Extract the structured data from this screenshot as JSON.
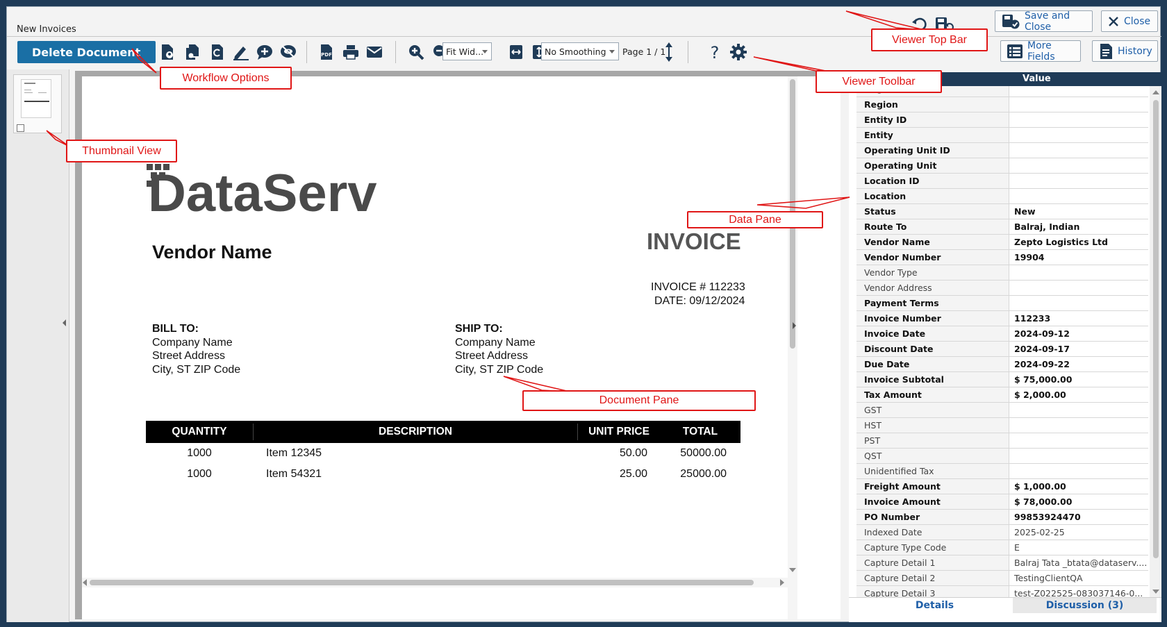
{
  "window": {
    "title": "New Invoices"
  },
  "top_bar": {
    "save_close_label": "Save and Close",
    "close_label": "Close",
    "more_fields_label": "More Fields",
    "history_label": "History"
  },
  "toolbar": {
    "delete_label": "Delete Document",
    "zoom_select": "Fit Wid...",
    "smoothing_select": "No Smoothing",
    "page_indicator": "Page 1 / 1"
  },
  "document": {
    "logo_text": "DataServ",
    "vendor_name": "Vendor Name",
    "heading": "INVOICE",
    "invoice_no": "INVOICE # 112233",
    "date": "DATE: 09/12/2024",
    "bill_to": {
      "title": "BILL TO:",
      "lines": [
        "Company Name",
        "Street Address",
        "City, ST ZIP Code"
      ]
    },
    "ship_to": {
      "title": "SHIP TO:",
      "lines": [
        "Company Name",
        "Street Address",
        "City, ST ZIP Code"
      ]
    },
    "table": {
      "headers": [
        "QUANTITY",
        "DESCRIPTION",
        "UNIT PRICE",
        "TOTAL"
      ],
      "rows": [
        [
          "1000",
          "Item 12345",
          "50.00",
          "50000.00"
        ],
        [
          "1000",
          "Item 54321",
          "25.00",
          "25000.00"
        ]
      ]
    }
  },
  "data_pane": {
    "header": "Value",
    "tabs": {
      "details": "Details",
      "discussion": "Discussion (3)"
    },
    "rows": [
      {
        "label": "Region ID",
        "value": ""
      },
      {
        "label": "Region",
        "value": ""
      },
      {
        "label": "Entity ID",
        "value": ""
      },
      {
        "label": "Entity",
        "value": ""
      },
      {
        "label": "Operating Unit ID",
        "value": ""
      },
      {
        "label": "Operating Unit",
        "value": ""
      },
      {
        "label": "Location ID",
        "value": ""
      },
      {
        "label": "Location",
        "value": ""
      },
      {
        "label": "Status",
        "value": "New"
      },
      {
        "label": "Route To",
        "value": "Balraj, Indian"
      },
      {
        "label": "Vendor Name",
        "value": "Zepto Logistics Ltd"
      },
      {
        "label": "Vendor Number",
        "value": "19904"
      },
      {
        "label": "Vendor Type",
        "value": ""
      },
      {
        "label": "Vendor Address",
        "value": ""
      },
      {
        "label": "Payment Terms",
        "value": ""
      },
      {
        "label": "Invoice Number",
        "value": "112233"
      },
      {
        "label": "Invoice Date",
        "value": "2024-09-12"
      },
      {
        "label": "Discount Date",
        "value": "2024-09-17"
      },
      {
        "label": "Due Date",
        "value": "2024-09-22"
      },
      {
        "label": "Invoice Subtotal",
        "value": "$ 75,000.00"
      },
      {
        "label": "Tax Amount",
        "value": "$ 2,000.00"
      },
      {
        "label": "GST",
        "value": ""
      },
      {
        "label": "HST",
        "value": ""
      },
      {
        "label": "PST",
        "value": ""
      },
      {
        "label": "QST",
        "value": ""
      },
      {
        "label": "Unidentified Tax",
        "value": ""
      },
      {
        "label": "Freight Amount",
        "value": "$ 1,000.00"
      },
      {
        "label": "Invoice Amount",
        "value": "$ 78,000.00"
      },
      {
        "label": "PO Number",
        "value": "99853924470"
      },
      {
        "label": "Indexed Date",
        "value": "2025-02-25"
      },
      {
        "label": "Capture Type Code",
        "value": "E"
      },
      {
        "label": "Capture Detail 1",
        "value": "Balraj Tata _btata@dataserv...."
      },
      {
        "label": "Capture Detail 2",
        "value": "TestingClientQA"
      },
      {
        "label": "Capture Detail 3",
        "value": "test-Z022525-083037146-0..."
      }
    ]
  },
  "callouts": {
    "workflow": "Workflow Options",
    "thumbnail": "Thumbnail View",
    "viewer_top_bar": "Viewer Top Bar",
    "viewer_toolbar": "Viewer Toolbar",
    "data_pane": "Data Pane",
    "document_pane": "Document Pane"
  },
  "colors": {
    "brand_blue": "#1a6fa5",
    "dark_header": "#1f3b57",
    "callout_red": "#e01616"
  }
}
